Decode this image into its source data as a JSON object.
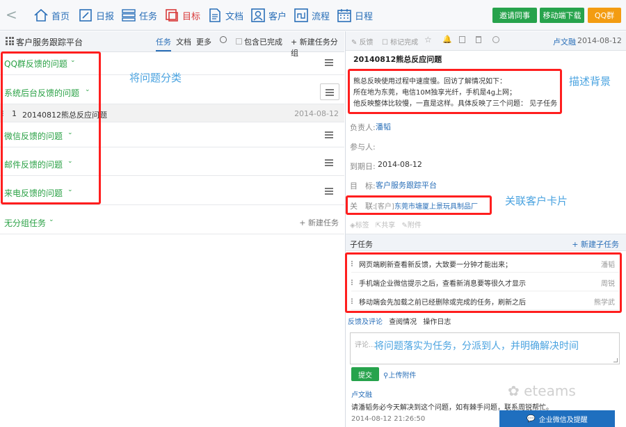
{
  "nav": {
    "back": "<",
    "items": [
      {
        "label": "首页"
      },
      {
        "label": "日报"
      },
      {
        "label": "任务"
      },
      {
        "label": "目标"
      },
      {
        "label": "文档"
      },
      {
        "label": "客户"
      },
      {
        "label": "流程"
      },
      {
        "label": "日程"
      }
    ],
    "invite": "邀请同事",
    "mobile": "移动端下载",
    "qq": "QQ群"
  },
  "list": {
    "app_title": "客户服务跟踪平台",
    "tabs": [
      "任务",
      "文档",
      "更多"
    ],
    "include_done": "包含已完成",
    "new_group": "+ 新建任务分组",
    "groups": [
      {
        "name": "QQ群反馈的问题"
      },
      {
        "name": "系统后台反馈的问题"
      },
      {
        "name": "微信反馈的问题"
      },
      {
        "name": "邮件反馈的问题"
      },
      {
        "name": "来电反馈的问题"
      }
    ],
    "task": {
      "num": "1",
      "title": "20140812熊总反应问题",
      "date": "2014-08-12"
    },
    "ungrouped": "无分组任务",
    "new_task": "+ 新建任务"
  },
  "detail": {
    "toolbar": {
      "feedback": "反馈",
      "mark_done": "标记完成",
      "owner": "卢文融",
      "date": "2014-08-12"
    },
    "title": "20140812熊总反应问题",
    "desc": [
      "熊总反映使用过程中速度慢。回访了解情况如下：",
      "所在地为东莞，电信10M独享光纤，手机是4g上网；",
      "他反映整体比较慢，一直是这样。具体反映了三个问题： 见子任务"
    ],
    "fields": {
      "assignee_label": "负责人:",
      "assignee": "潘韬",
      "participants_label": "参与人:",
      "due_label": "到期日:",
      "due": "2014-08-12",
      "goal_label": "目　标:",
      "goal": "客户服务跟踪平台",
      "related_label": "关　联:",
      "related_tag": "[客户]",
      "related": "东莞市塘厦上景玩具制品厂"
    },
    "tags": [
      "标签",
      "共享",
      "附件"
    ],
    "subtasks_label": "子任务",
    "new_subtask": "+ 新建子任务",
    "subtasks": [
      {
        "text": "网页端刷新查看新反馈，大致要一分钟才能出来；",
        "who": "潘韬"
      },
      {
        "text": "手机端企业微信提示之后，查看新消息要等很久才显示",
        "who": "周锐"
      },
      {
        "text": "移动端会先加载之前已经删除或完成的任务，刷新之后",
        "who": "熊学武"
      }
    ],
    "comment_tabs": [
      "反馈及评论",
      "查阅情况",
      "操作日志"
    ],
    "comment_placeholder": "评论...",
    "submit": "提交",
    "upload": "上传附件",
    "comment": {
      "author": "卢文融",
      "text": "请潘韬务必今天解决到这个问题，如有棘手问题，联系周锐帮忙。",
      "time": "2014-08-12 21:26:50"
    },
    "wechat_btn": "企业微信及提醒"
  },
  "annotations": {
    "classify": "将问题分类",
    "background": "描述背景",
    "customer": "关联客户卡片",
    "assign": "将问题落实为任务，分派到人，并明确解决时间"
  },
  "watermark": "eteams"
}
